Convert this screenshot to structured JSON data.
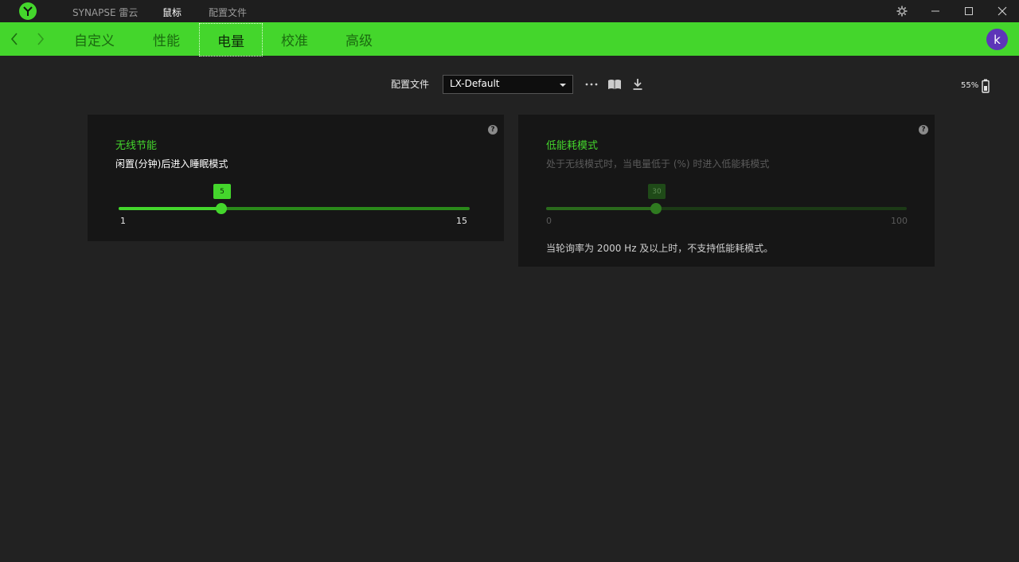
{
  "titlebar": {
    "app_name": "SYNAPSE 雷云",
    "tabs": [
      "鼠标",
      "配置文件"
    ],
    "active_tab": "鼠标",
    "buttons": [
      "gear-icon",
      "minimize-icon",
      "maximize-icon",
      "close-icon"
    ]
  },
  "nav": {
    "tabs": [
      "自定义",
      "性能",
      "电量",
      "校准",
      "高级"
    ],
    "active_tab": "电量",
    "avatar_letter": "k"
  },
  "profile": {
    "label": "配置文件",
    "selected": "LX-Default",
    "icons": [
      "more-icon",
      "book-icon",
      "download-icon"
    ]
  },
  "battery": {
    "percent_text": "55%"
  },
  "wireless_panel": {
    "title": "无线节能",
    "description": "闲置(分钟)后进入睡眠模式",
    "slider": {
      "min": "1",
      "max": "15",
      "value": "5",
      "fraction": 0.2857
    }
  },
  "lowpower_panel": {
    "title": "低能耗模式",
    "description": "处于无线模式时，当电量低于 (%) 时进入低能耗模式",
    "slider": {
      "min": "0",
      "max": "100",
      "value": "30",
      "fraction": 0.3,
      "enabled": false
    },
    "note": "当轮询率为 2000 Hz 及以上时，不支持低能耗模式。"
  },
  "colors": {
    "accent": "#44d62c",
    "background": "#222222",
    "panel": "#161616",
    "avatar": "#5d35b8"
  }
}
